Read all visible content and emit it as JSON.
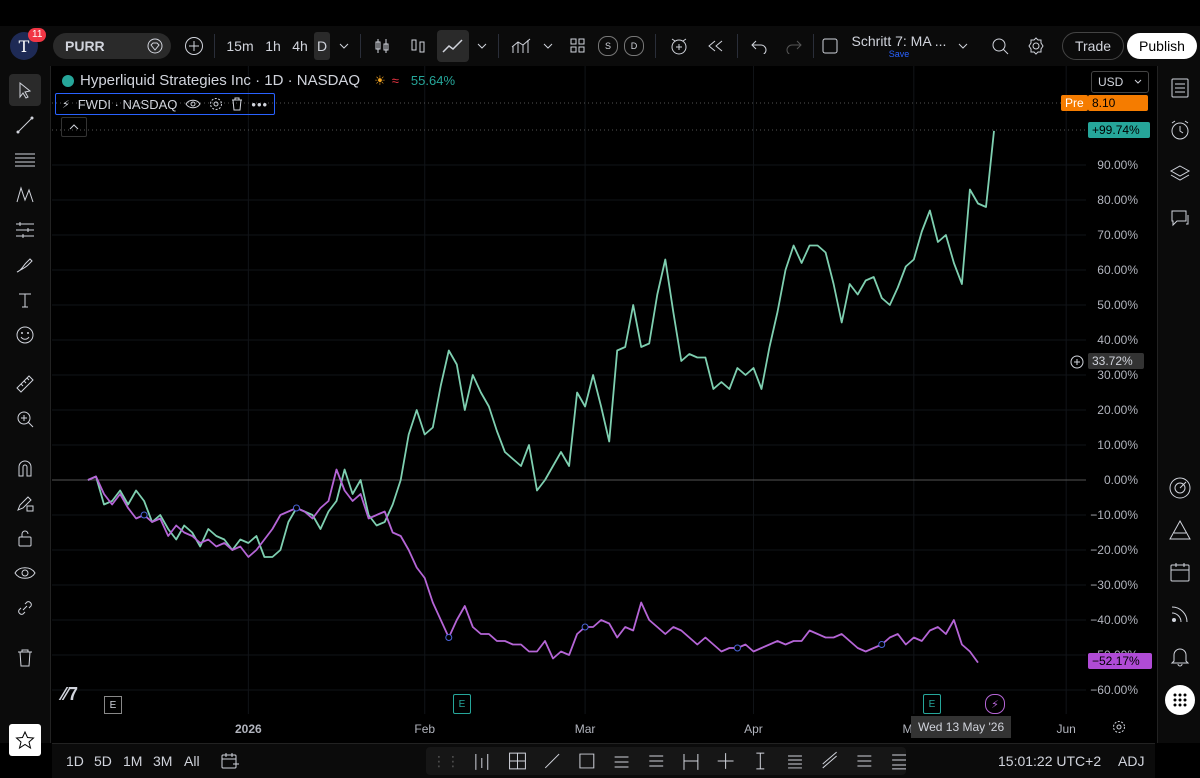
{
  "topbar": {
    "notif_count": "11",
    "symbol": "PURR",
    "intervals": [
      "15m",
      "1h",
      "4h",
      "D"
    ],
    "active_interval": "D",
    "layout_name": "Schritt 7: MA ...",
    "layout_save": "Save",
    "trade_label": "Trade",
    "publish_label": "Publish"
  },
  "legend": {
    "main_title": "Hyperliquid Strategies Inc · 1D · NASDAQ",
    "main_change": "55.64%",
    "compare_title": "FWDI · NASDAQ"
  },
  "price_scale": {
    "currency": "USD",
    "pre_label": "Pre",
    "pre_value": "8.10",
    "main_last": "+99.74%",
    "compare_last": "−52.17%",
    "crosshair_value": "33.72%"
  },
  "bottombar": {
    "ranges": [
      "1D",
      "5D",
      "1M",
      "3M",
      "All"
    ],
    "clock": "15:01:22 UTC+2",
    "adj": "ADJ",
    "hover_date": "Wed 13 May '26"
  },
  "colors": {
    "main_series": "#7ecfb0",
    "compare_series": "#b565d6",
    "accent": "#2962ff",
    "pre_badge": "#f57c00",
    "positive_badge": "#26a69a",
    "negative_badge": "#b04bd6"
  },
  "chart_data": {
    "type": "line",
    "title": "",
    "xlabel": "",
    "ylabel": "",
    "ylim": [
      -65,
      102
    ],
    "y_unit": "%",
    "y_ticks": [
      "90.00%",
      "80.00%",
      "70.00%",
      "60.00%",
      "50.00%",
      "40.00%",
      "30.00%",
      "20.00%",
      "10.00%",
      "0.00%",
      "−10.00%",
      "−20.00%",
      "−30.00%",
      "−40.00%",
      "−50.00%",
      "−60.00%"
    ],
    "y_tick_values": [
      90,
      80,
      70,
      60,
      50,
      40,
      30,
      20,
      10,
      0,
      -10,
      -20,
      -30,
      -40,
      -50,
      -60
    ],
    "x_labels": [
      "2026",
      "Feb",
      "Mar",
      "Apr",
      "May",
      "Jun"
    ],
    "x_label_index": [
      20,
      42,
      62,
      83,
      103,
      122
    ],
    "grid": true,
    "series": [
      {
        "name": "Hyperliquid Strategies Inc",
        "values": [
          0,
          1,
          -7,
          -6,
          -3,
          -7,
          -3,
          -6,
          -12,
          -10,
          -14,
          -17,
          -13,
          -15,
          -19,
          -14,
          -16,
          -17,
          -20,
          -17,
          -18,
          -16,
          -22,
          -22,
          -20,
          -12,
          -8,
          -9,
          -10,
          -14,
          -9,
          -6,
          3,
          -4,
          0,
          -10,
          -13,
          -12,
          -7,
          0,
          13,
          20,
          13,
          15,
          27,
          37,
          33,
          20,
          30,
          25,
          21,
          14,
          8,
          6,
          4,
          10,
          -3,
          0,
          4,
          8,
          4,
          25,
          21,
          30,
          21,
          11,
          37,
          38,
          50,
          38,
          39,
          53,
          63,
          48,
          34,
          36,
          35,
          35,
          26,
          28,
          26,
          32,
          30,
          32,
          26,
          38,
          48,
          60,
          67,
          62,
          67,
          67,
          65,
          56,
          45,
          56,
          53,
          57,
          58,
          52,
          50,
          55,
          61,
          63,
          71,
          77,
          68,
          70,
          62,
          56,
          83,
          79,
          78,
          99.74
        ]
      },
      {
        "name": "FWDI",
        "values": [
          0,
          1,
          -4,
          -7,
          -4,
          -8,
          -11,
          -10,
          -12,
          -11,
          -16,
          -13,
          -15,
          -16,
          -18,
          -17,
          -19,
          -18,
          -20,
          -19,
          -22,
          -20,
          -17,
          -14,
          -10,
          -9,
          -8,
          -9,
          -11,
          -8,
          -6,
          3,
          -3,
          -6,
          -4,
          -11,
          -10,
          -9,
          -15,
          -16,
          -20,
          -25,
          -28,
          -35,
          -40,
          -45,
          -40,
          -36,
          -42,
          -44,
          -44,
          -46,
          -46,
          -47,
          -47,
          -49,
          -49,
          -46,
          -51,
          -49,
          -50,
          -44,
          -42,
          -42,
          -40,
          -41,
          -45,
          -42,
          -43,
          -35,
          -40,
          -42,
          -44,
          -42,
          -43,
          -45,
          -47,
          -45,
          -47,
          -49,
          -48,
          -48,
          -47,
          -49,
          -48,
          -47,
          -46,
          -47,
          -46,
          -46,
          -43,
          -44,
          -45,
          -45,
          -44,
          -46,
          -48,
          -49,
          -48,
          -47,
          -45,
          -44,
          -47,
          -45,
          -46,
          -43,
          -42,
          -44,
          -40,
          -47,
          -49,
          -52.17
        ]
      }
    ],
    "annotations": [
      "E",
      "E",
      "E"
    ]
  }
}
